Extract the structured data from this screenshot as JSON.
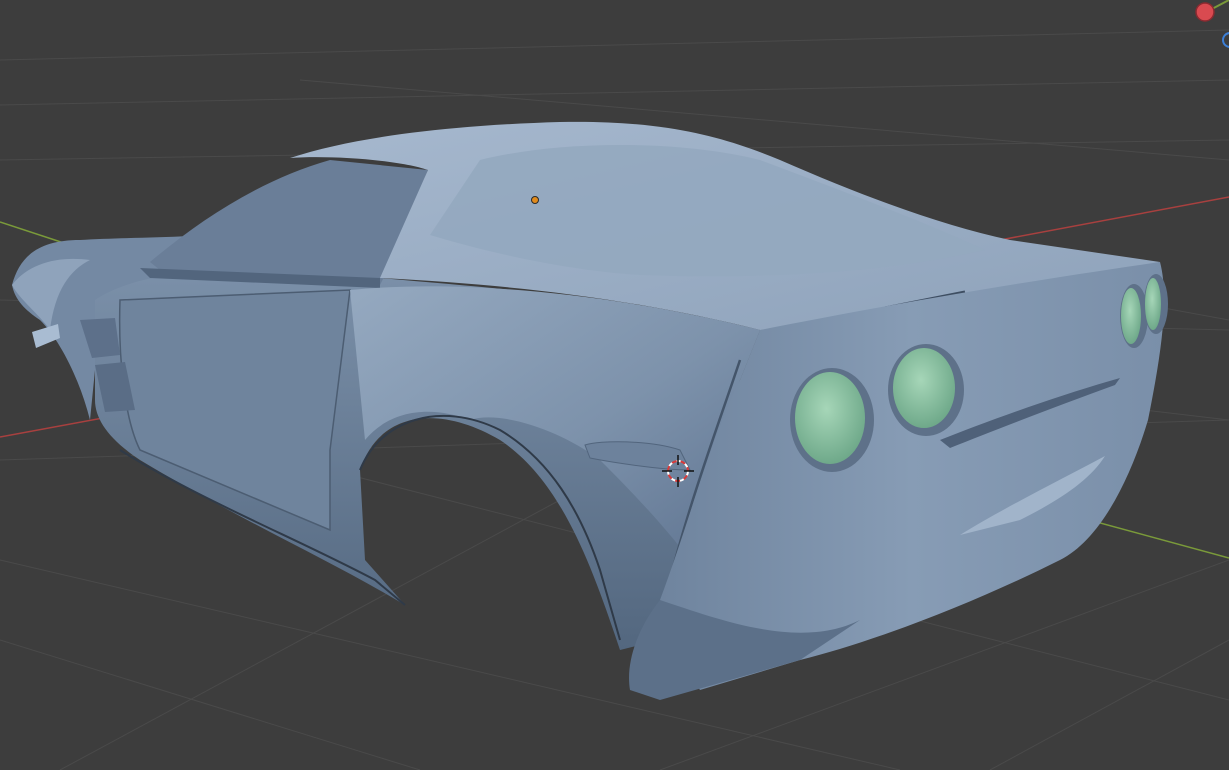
{
  "viewport": {
    "background_color": "#3d3d3d",
    "grid_color": "#4a4a4a",
    "x_axis_color": "#a8403f",
    "y_axis_color": "#7a9a3a",
    "mesh_base_color": "#7f93aa",
    "mesh_shadow_color": "#566a82",
    "mesh_highlight_color": "#a9bcd2",
    "taillight_color": "#8fc2a4",
    "origin_dot_color": "#e08a1c",
    "cursor_red": "#d93a3a"
  },
  "navigation_gizmo": {
    "x_axis_icon": "x-axis-circle-icon",
    "z_axis_icon": "z-axis-circle-icon",
    "x_color": "#d94a50",
    "z_color": "#3d7fd6"
  },
  "object": {
    "icon": "car-body-mesh",
    "origin_icon": "object-origin-dot-icon",
    "cursor_icon": "3d-cursor-icon"
  }
}
